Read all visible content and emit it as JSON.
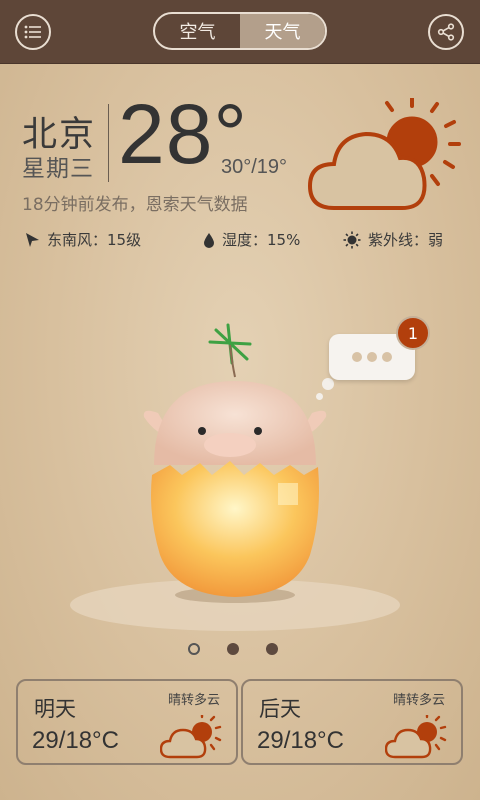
{
  "topbar": {
    "menu_icon": "menu-icon",
    "share_icon": "share-icon",
    "tabs": [
      {
        "label": "空气",
        "active": false
      },
      {
        "label": "天气",
        "active": true
      }
    ]
  },
  "weather": {
    "city": "北京",
    "weekday": "星期三",
    "temperature": "28°",
    "range": "30°/19°",
    "published": "18分钟前发布，恩索天气数据",
    "icon": "cloudy-sun-icon",
    "accent_color": "#b23f0c"
  },
  "stats": {
    "wind": "东南风：15级",
    "humidity": "湿度：15%",
    "uv": "紫外线：弱"
  },
  "mascot": {
    "badge_count": "1"
  },
  "pager": {
    "pages": 3,
    "current": 1
  },
  "forecast": [
    {
      "day": "明天",
      "condition": "晴转多云",
      "temp": "29/18°C",
      "icon": "cloudy-sun-icon"
    },
    {
      "day": "后天",
      "condition": "晴转多云",
      "temp": "29/18°C",
      "icon": "cloudy-sun-icon"
    }
  ]
}
